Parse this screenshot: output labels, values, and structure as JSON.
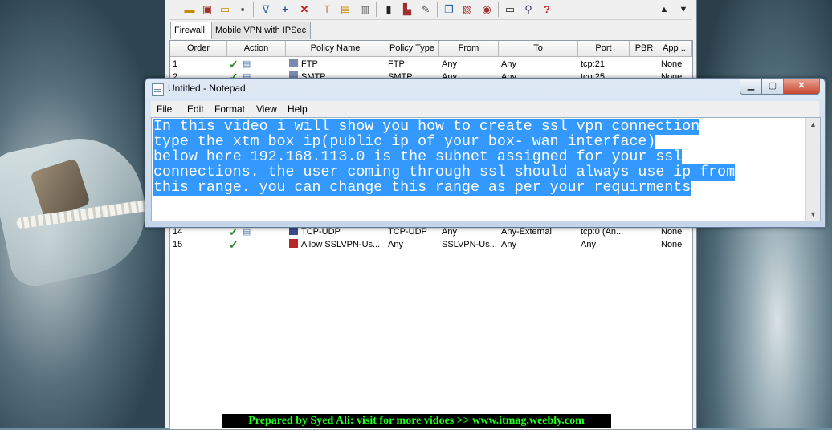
{
  "firewall_window": {
    "tabs": [
      "Firewall",
      "Mobile VPN with IPSec"
    ],
    "columns": [
      "Order",
      "Action",
      "Policy Name",
      "Policy Type",
      "From",
      "To",
      "Port",
      "PBR",
      "App ..."
    ],
    "rows_top": [
      {
        "order": "1",
        "name": "FTP",
        "type": "FTP",
        "from": "Any",
        "to": "Any",
        "port": "tcp:21",
        "app": "None"
      },
      {
        "order": "2",
        "name": "SMTP",
        "type": "SMTP",
        "from": "Any",
        "to": "Any",
        "port": "tcp:25",
        "app": "None"
      }
    ],
    "rows_bottom": [
      {
        "order": "14",
        "name": "TCP-UDP",
        "type": "TCP-UDP",
        "from": "Any",
        "to": "Any-External",
        "port": "tcp:0 (An...",
        "app": "None"
      },
      {
        "order": "15",
        "name": "Allow SSLVPN-Us...",
        "type": "Any",
        "from": "SSLVPN-Us...",
        "to": "Any",
        "port": "Any",
        "app": "None"
      }
    ]
  },
  "notepad": {
    "title": "Untitled - Notepad",
    "menu": [
      "File",
      "Edit",
      "Format",
      "View",
      "Help"
    ],
    "lines": [
      "In this video i will show you how to create ssl vpn connection",
      "type the xtm box ip(public ip of your box- wan interface)",
      "below here 192.168.113.0 is the subnet assigned for your ssl",
      "connections. the user coming through ssl should always use ip from",
      "this range. you can change this range as per your requirments"
    ]
  },
  "banner": {
    "text": "Prepared by Syed Ali: visit for more vidoes >> www.itmag.weebly.com"
  }
}
